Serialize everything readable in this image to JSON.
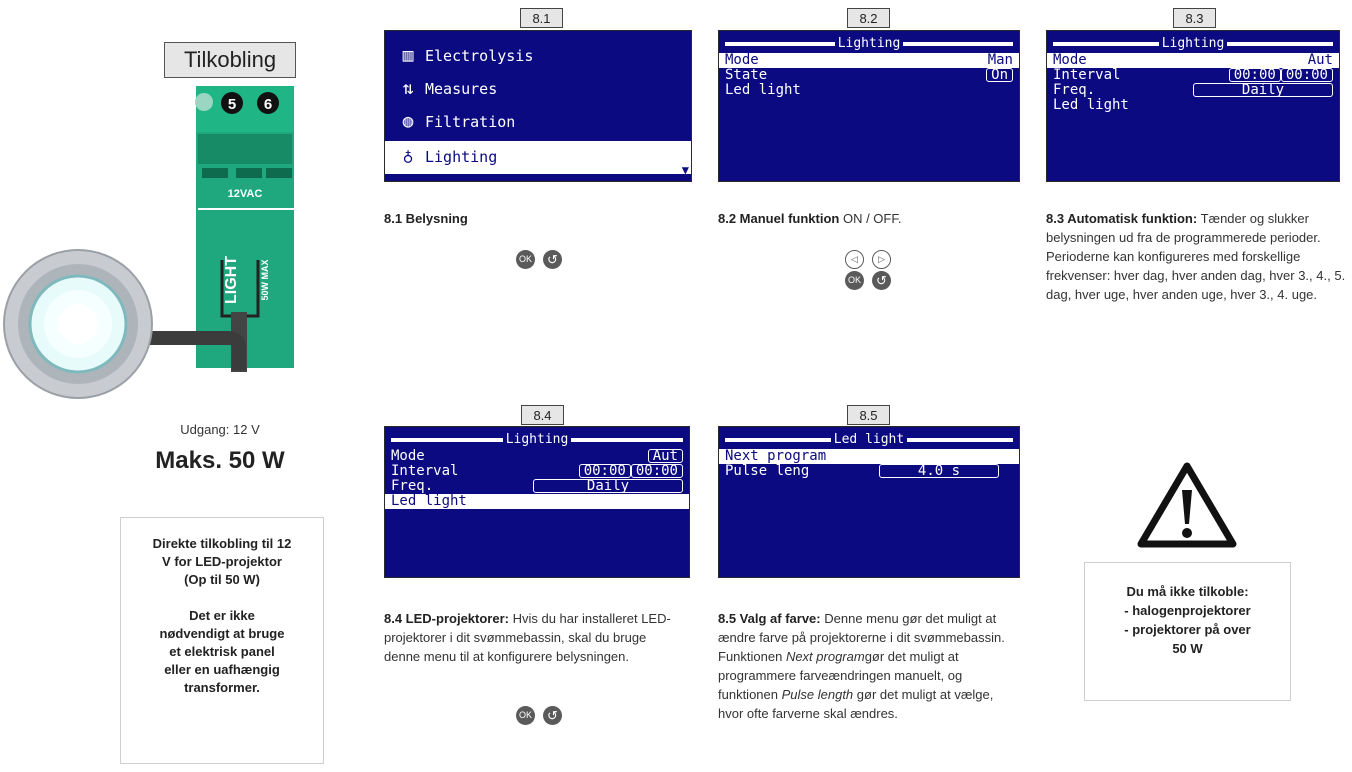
{
  "left": {
    "connection_label": "Tilkobling",
    "terminals": [
      "5",
      "6"
    ],
    "board_labels": [
      "12VAC",
      "LIGHT",
      "50W MAX"
    ],
    "output_label": "Udgang: 12 V",
    "max_power": "Maks. 50 W",
    "note_lines": [
      "Direkte tilkobling til 12",
      "V for LED-projektor",
      "(Op til 50 W)",
      "",
      "Det er ikke",
      "nødvendigt at bruge",
      "et elektrisk panel",
      "eller en uafhængig",
      "transformer."
    ]
  },
  "screens": {
    "s81": {
      "tag": "8.1",
      "items": [
        {
          "icon": "filter-icon",
          "label": "Electrolysis"
        },
        {
          "icon": "up-down-arrows-icon",
          "label": "Measures"
        },
        {
          "icon": "filtration-icon",
          "label": "Filtration"
        },
        {
          "icon": "bulb-icon",
          "label": "Lighting"
        }
      ]
    },
    "s82": {
      "tag": "8.2",
      "title": "Lighting",
      "rows": [
        {
          "label": "Mode",
          "value": "Man"
        },
        {
          "label": "State",
          "value": "On"
        },
        {
          "label": "Led light",
          "value": ""
        }
      ]
    },
    "s83": {
      "tag": "8.3",
      "title": "Lighting",
      "rows": [
        {
          "label": "Mode",
          "value": "Aut"
        },
        {
          "label": "Interval",
          "value": "00:00",
          "value2": "00:00"
        },
        {
          "label": "Freq.",
          "value": "Daily"
        },
        {
          "label": "Led light",
          "value": ""
        }
      ]
    },
    "s84": {
      "tag": "8.4",
      "title": "Lighting",
      "rows": [
        {
          "label": "Mode",
          "value": "Aut"
        },
        {
          "label": "Interval",
          "value": "00:00",
          "value2": "00:00"
        },
        {
          "label": "Freq.",
          "value": "Daily"
        },
        {
          "label": "Led light",
          "value": ""
        }
      ]
    },
    "s85": {
      "tag": "8.5",
      "title": "Led light",
      "rows": [
        {
          "label": "Next program",
          "value": ""
        },
        {
          "label": "Pulse leng",
          "value": "4.0 s"
        }
      ]
    }
  },
  "captions": {
    "c81": {
      "bold": "8.1 Belysning",
      "text": ""
    },
    "c82": {
      "bold": "8.2 Manuel funktion",
      "text": " ON / OFF."
    },
    "c83": {
      "bold": "8.3 Automatisk funktion:",
      "text": " Tænder og slukker belysningen ud fra de programmerede perioder. Perioderne kan konfigureres med forskellige frekvenser: hver dag, hver anden dag, hver 3., 4., 5. dag, hver uge, hver anden uge, hver 3., 4. uge."
    },
    "c84": {
      "bold": "8.4 LED-projektorer:",
      "text": " Hvis du har installeret LED-projektorer i dit svømmebassin, skal du bruge denne menu til at konfigurere belysningen."
    },
    "c85": {
      "bold": "8.5 Valg af farve:",
      "text1": " Denne menu gør det muligt at ændre farve på projektorerne i dit svømmebassin.",
      "text2a": "Funktionen ",
      "em1": "Next program",
      "text2b": "gør det muligt at programmere farveændringen manuelt, og funktionen ",
      "em2": "Pulse length",
      "text2c": " gør det muligt at vælge, hvor ofte farverne skal ændres."
    }
  },
  "buttons": {
    "ok": "OK",
    "back": "↺",
    "left": "◁",
    "right": "▷"
  },
  "warning": {
    "lines": [
      "Du må ikke tilkoble:",
      "- halogenprojektorer",
      "- projektorer på over",
      "50 W"
    ]
  },
  "colors": {
    "lcd_bg": "#0b0a80",
    "board_green": "#1fa77d",
    "button_gray": "#5a5a5a"
  }
}
